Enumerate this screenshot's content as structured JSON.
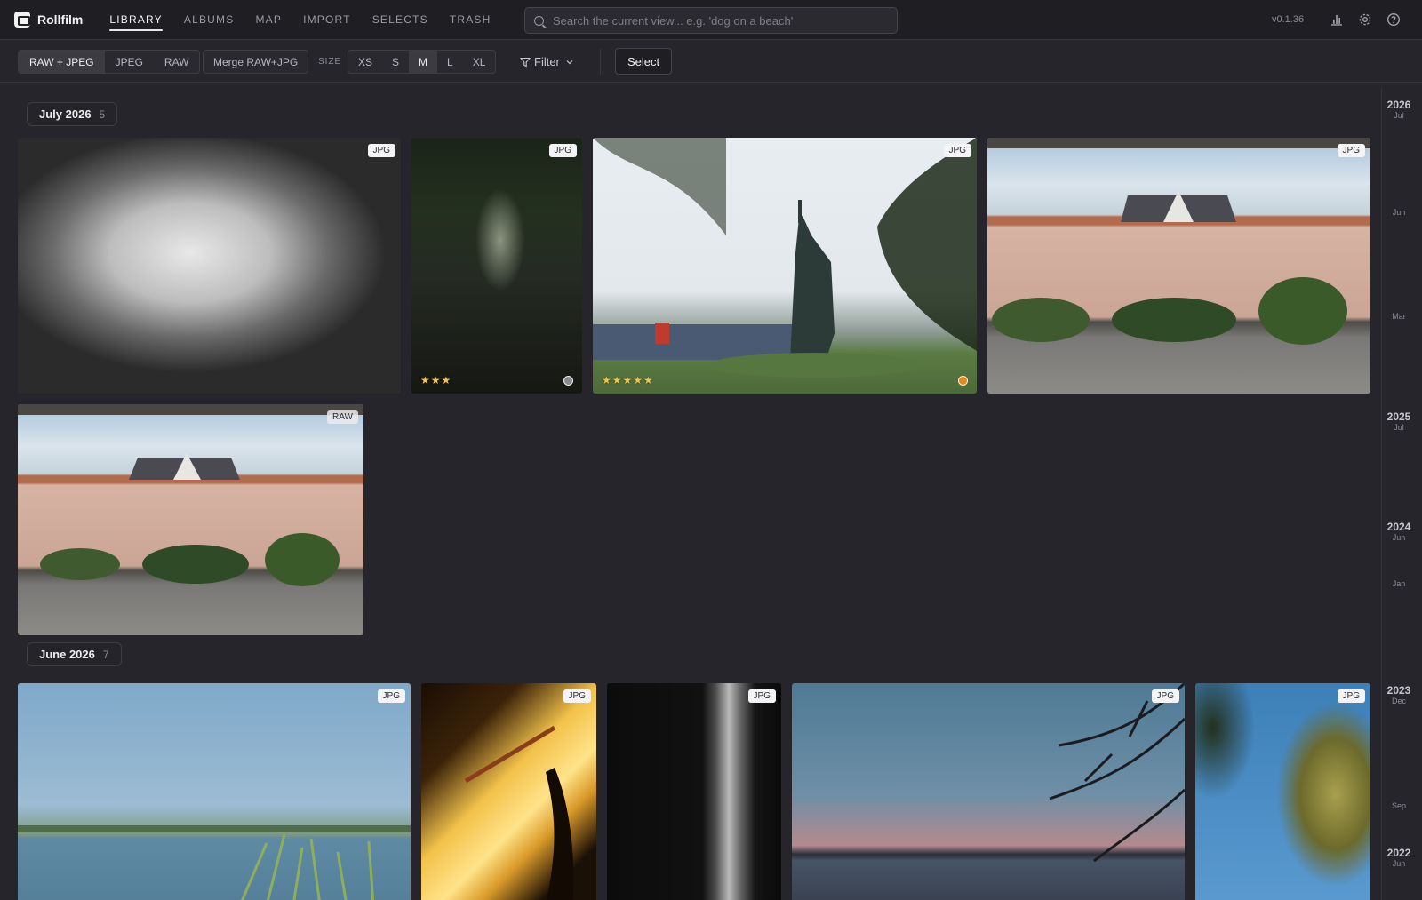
{
  "app": {
    "name": "Rollfilm",
    "version": "v0.1.36"
  },
  "nav": {
    "items": [
      {
        "label": "LIBRARY",
        "active": true
      },
      {
        "label": "ALBUMS",
        "active": false
      },
      {
        "label": "MAP",
        "active": false
      },
      {
        "label": "IMPORT",
        "active": false
      },
      {
        "label": "SELECTS",
        "active": false
      },
      {
        "label": "TRASH",
        "active": false
      }
    ]
  },
  "search": {
    "placeholder": "Search the current view... e.g. 'dog on a beach'",
    "value": ""
  },
  "icons": {
    "stats": "bar-chart-icon",
    "settings": "gear-icon",
    "help": "help-icon",
    "search": "search-icon",
    "filter": "filter-icon"
  },
  "toolbar": {
    "format_options": [
      {
        "label": "RAW + JPEG",
        "active": true
      },
      {
        "label": "JPEG",
        "active": false
      },
      {
        "label": "RAW",
        "active": false
      }
    ],
    "merge_label": "Merge RAW+JPG",
    "size_label": "SIZE",
    "size_options": [
      {
        "label": "XS",
        "active": false
      },
      {
        "label": "S",
        "active": false
      },
      {
        "label": "M",
        "active": true
      },
      {
        "label": "L",
        "active": false
      },
      {
        "label": "XL",
        "active": false
      }
    ],
    "filter_label": "Filter",
    "select_label": "Select"
  },
  "sections": [
    {
      "title": "July 2026",
      "count": "5",
      "photos": [
        {
          "format": "JPG",
          "scene": "graffiti",
          "stars": "",
          "dot": ""
        },
        {
          "format": "JPG",
          "scene": "park",
          "stars": "★★★",
          "dot": "#8a8a8f"
        },
        {
          "format": "JPG",
          "scene": "liberty",
          "stars": "★★★★★",
          "dot": "#e58a1c"
        },
        {
          "format": "JPG",
          "scene": "wall",
          "stars": "",
          "dot": ""
        },
        {
          "format": "RAW",
          "scene": "wall",
          "stars": "",
          "dot": ""
        }
      ]
    },
    {
      "title": "June 2026",
      "count": "7",
      "photos": [
        {
          "format": "JPG",
          "scene": "lake"
        },
        {
          "format": "JPG",
          "scene": "window"
        },
        {
          "format": "JPG",
          "scene": "curtain"
        },
        {
          "format": "JPG",
          "scene": "sunset"
        },
        {
          "format": "JPG",
          "scene": "tree"
        }
      ]
    }
  ],
  "timeline": [
    {
      "year": "2026",
      "month": "Jul"
    },
    {
      "year": "",
      "month": "Jun"
    },
    {
      "year": "",
      "month": "Mar"
    },
    {
      "year": "2025",
      "month": "Jul"
    },
    {
      "year": "2024",
      "month": "Jun"
    },
    {
      "year": "",
      "month": "Jan"
    },
    {
      "year": "2023",
      "month": "Dec"
    },
    {
      "year": "",
      "month": "Sep"
    },
    {
      "year": "2022",
      "month": "Jun"
    }
  ]
}
